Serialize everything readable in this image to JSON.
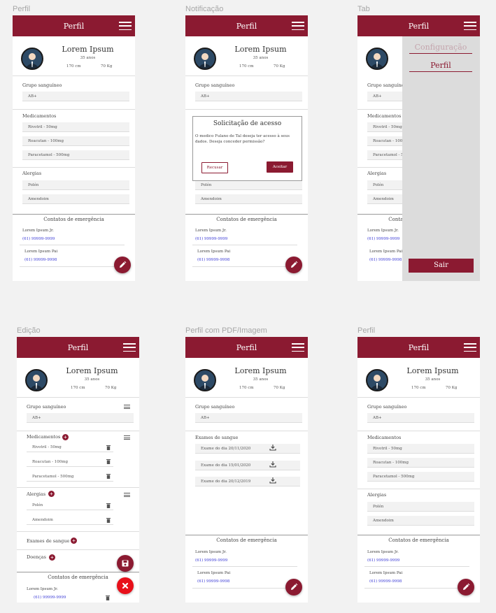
{
  "frames": {
    "perfil1": "Perfil",
    "notificacao": "Notificação",
    "tab": "Tab",
    "edicao": "Edição",
    "pdf": "Perfil com PDF/Imagem",
    "perfil2": "Perfil"
  },
  "header_title": "Perfil",
  "profile": {
    "name": "Lorem Ipsum",
    "age": "35 anos",
    "height": "170 cm",
    "weight": "70 Kg"
  },
  "blood": {
    "label": "Grupo sanguíneo",
    "value": "AB+"
  },
  "meds": {
    "label": "Medicamentos",
    "items": [
      "Rivotril  -  50mg",
      "Roacutan - 100mg",
      "Paracetamol - 500mg"
    ]
  },
  "allergies": {
    "label": "Alergias",
    "items": [
      "Polén",
      "Amendoim"
    ]
  },
  "contacts": {
    "title": "Contatos de emergência",
    "c1_name": "Lorem Ipsum Jr.",
    "c1_phone": "(61) 99999-9999",
    "c2_name": "Lorem Ipsum Pai",
    "c2_phone": "(61) 99999-9998"
  },
  "dialog": {
    "title": "Solicitação de acesso",
    "body": "O medico Fulano de Tal deseja ter acesso à seus dados. Deseja conceder permissão?",
    "refuse": "Recusar",
    "accept": "Aceitar"
  },
  "drawer": {
    "item1": "Configuração",
    "item2": "Perfil",
    "logout": "Sair"
  },
  "edit": {
    "exams_label": "Exames de sangue",
    "diseases_label": "Doenças"
  },
  "exams": {
    "label": "Exames de sangue",
    "items": [
      "Exame do dia 20/11/2020",
      "Exame do dia 15/01/2020",
      "Exame do dia 20/12/2019"
    ]
  },
  "icons": {
    "menu": "hamburger-icon",
    "edit": "pencil-icon",
    "save": "floppy-icon",
    "close": "x-icon",
    "delete": "trash-icon",
    "add": "plus-icon",
    "reorder": "drag-lines-icon",
    "download": "download-icon"
  },
  "colors": {
    "brand": "#8b1a31",
    "close_fab": "#e8101a",
    "phone_link": "#3b3bd6"
  }
}
